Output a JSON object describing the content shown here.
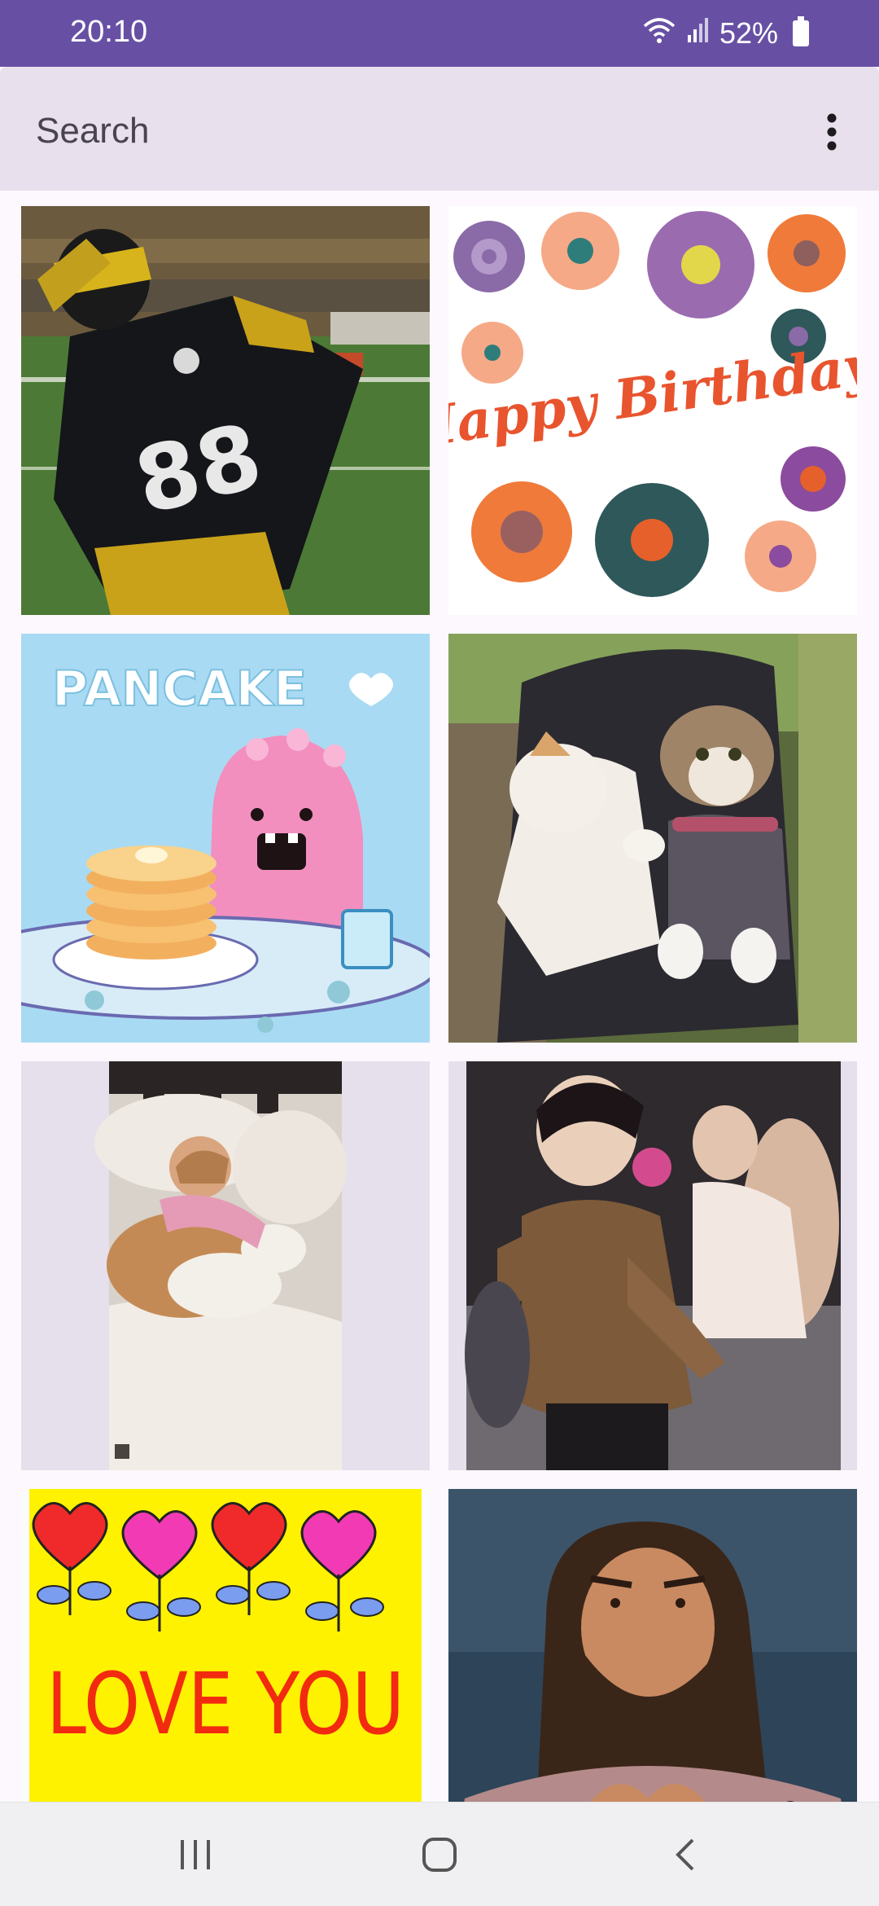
{
  "status_bar": {
    "time": "20:10",
    "battery": "52%",
    "icons": [
      "wifi-icon",
      "signal-icon",
      "battery-icon"
    ]
  },
  "search": {
    "placeholder": "Search",
    "menu_icon": "more-vert-icon"
  },
  "gifs": [
    {
      "name": "gif-football-dab",
      "label": "88"
    },
    {
      "name": "gif-happy-birthday",
      "label": "Happy Birthday!"
    },
    {
      "name": "gif-pancake",
      "label": "PANCAKE"
    },
    {
      "name": "gif-cats-stroller",
      "label": ""
    },
    {
      "name": "gif-baby-puppy",
      "label": ""
    },
    {
      "name": "gif-dancing",
      "label": ""
    },
    {
      "name": "gif-love-you",
      "label": "LOVE YOU"
    },
    {
      "name": "gif-heart-hands",
      "label": ""
    }
  ],
  "nav_bar": {
    "buttons": [
      "recents-icon",
      "home-icon",
      "back-icon"
    ]
  },
  "colors": {
    "status_bar": "#6750a4",
    "search_bar": "#e8e0ec",
    "background": "#fdf8fd"
  }
}
